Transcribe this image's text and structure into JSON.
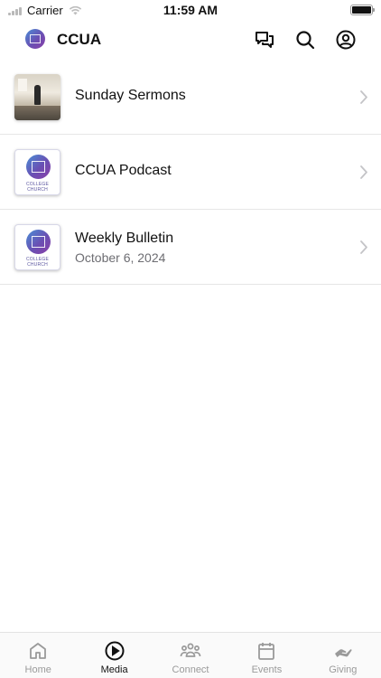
{
  "status_bar": {
    "carrier": "Carrier",
    "time": "11:59 AM"
  },
  "header": {
    "title": "CCUA",
    "icons": [
      "chat-icon",
      "search-icon",
      "profile-icon"
    ]
  },
  "media": {
    "items": [
      {
        "title": "Sunday Sermons",
        "subtitle": "",
        "thumb": "sermon-photo"
      },
      {
        "title": "CCUA Podcast",
        "subtitle": "",
        "thumb": "college-church-logo"
      },
      {
        "title": "Weekly Bulletin",
        "subtitle": "October 6, 2024",
        "thumb": "college-church-logo"
      }
    ],
    "logo_caption": "COLLEGE CHURCH"
  },
  "tabs": [
    {
      "label": "Home",
      "icon": "home-icon",
      "active": false
    },
    {
      "label": "Media",
      "icon": "play-icon",
      "active": true
    },
    {
      "label": "Connect",
      "icon": "people-icon",
      "active": false
    },
    {
      "label": "Events",
      "icon": "calendar-icon",
      "active": false
    },
    {
      "label": "Giving",
      "icon": "giving-hand-icon",
      "active": false
    }
  ],
  "colors": {
    "active_tab": "#111111",
    "inactive_tab": "#9a9a9a",
    "brand_gradient_start": "#4a8fd6",
    "brand_gradient_end": "#8a3fa8"
  }
}
